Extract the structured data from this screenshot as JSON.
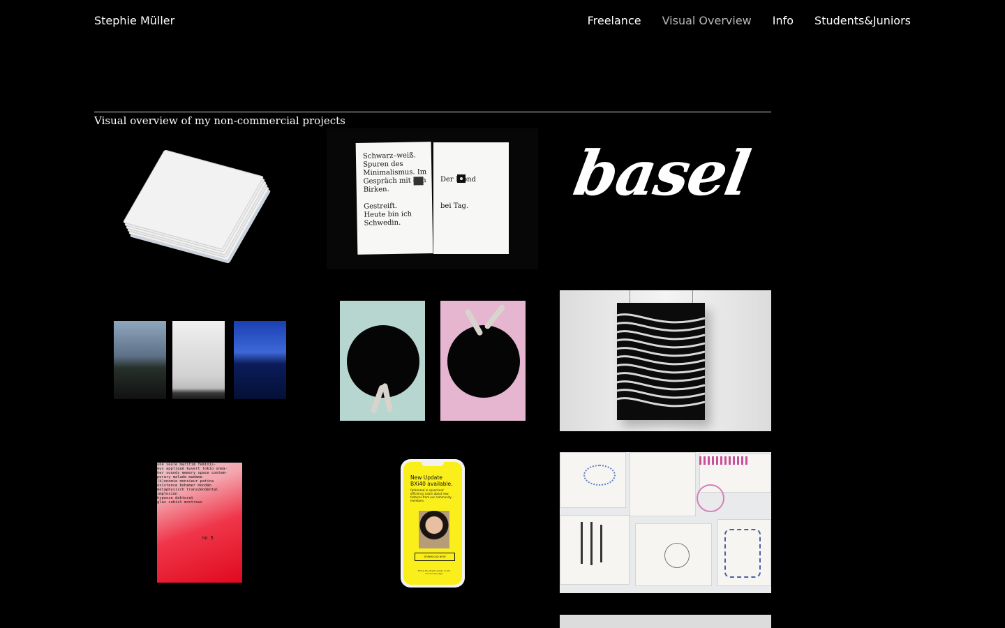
{
  "site": {
    "title": "Stephie Müller"
  },
  "nav": {
    "items": [
      {
        "label": "Freelance",
        "active": false
      },
      {
        "label": "Visual Overview",
        "active": true
      },
      {
        "label": "Info",
        "active": false
      },
      {
        "label": "Students&Juniors",
        "active": false
      }
    ]
  },
  "section": {
    "title": "Visual overview of my non-commercial projects"
  },
  "projects": {
    "book_spread": {
      "left_top": "Schwarz–weiß. Spuren des Minimalismus. Im Gespräch mit den Birken.",
      "left_bottom": "Gestreift. Heute bin ich Schwedin.",
      "right_top": "Der Mond",
      "right_bottom": "bei Tag."
    },
    "logo": {
      "text": "basel"
    },
    "red_poster": {
      "text": "une seule maritim feminis-\nmus appliqué kuvert tokio snea-\nker sounds memory space contem-\nporary malade madame\n(k)onomie monsieur patina\nexistence bohemer mondän\nmetaphysisch transzendental\nimplosion\nhypnose doktorat\nglas cubist montreux",
      "number": "no 5"
    },
    "phone": {
      "headline": "New Update BXi40 available.",
      "body": "Optimized in speed and efficiency. Learn about new features from our community members.",
      "button": "DOWNLOAD NOW",
      "footer": "Follow the latest update on the community page."
    }
  }
}
